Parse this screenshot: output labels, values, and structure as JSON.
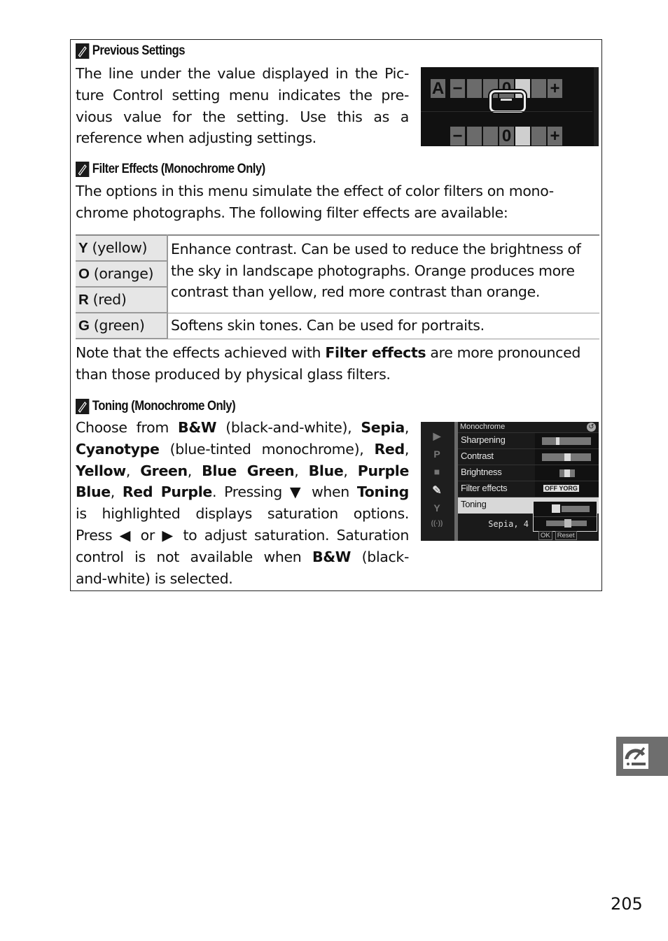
{
  "sections": {
    "previous_settings": {
      "heading": "Previous Settings",
      "lines": [
        "The line under the value displayed in the Pic-",
        "ture Control setting menu indicates the pre-",
        "vious value for the setting. Use this as a",
        "reference when adjusting settings."
      ],
      "screen": {
        "row1": [
          "A",
          "−",
          "",
          "",
          "0",
          "",
          "",
          "+"
        ],
        "row2": [
          "−",
          "",
          "",
          "0",
          "",
          "",
          "+"
        ]
      }
    },
    "filter_effects": {
      "heading": "Filter Effects (Monochrome Only)",
      "lines": [
        "The options in this menu simulate the effect of color filters on mono-",
        "chrome photographs. The following filter effects are available:"
      ],
      "table": [
        {
          "key": "Y",
          "name": "(yellow)"
        },
        {
          "key": "O",
          "name": "(orange)"
        },
        {
          "key": "R",
          "name": "(red)"
        },
        {
          "key": "G",
          "name": "(green)"
        }
      ],
      "desc_yor": [
        "Enhance contrast. Can be used to reduce the brightness of",
        "the sky in landscape photographs. Orange produces more",
        "contrast than yellow, red more contrast than orange."
      ],
      "desc_g": "Softens skin tones. Can be used for portraits.",
      "note_pre": "Note that the effects achieved with ",
      "note_bold": "Filter effects",
      "note_post": " are more pronounced",
      "note_line2": "than those produced by physical glass filters."
    },
    "toning": {
      "heading": "Toning (Monochrome Only)",
      "t": {
        "choose": "Choose from ",
        "bw": "B&W",
        "bw_desc": " (black-and-white), ",
        "sepia": "Sepia",
        "comma": ",",
        "cyan": "Cyanotype",
        "cyan_desc": " (blue-tinted monochrome), ",
        "red": "Red",
        "yellow": "Yellow",
        "green": "Green",
        "bluegreen": "Blue Green",
        "blue": "Blue",
        "purple": "Purple",
        "purpleblue2": "Blue",
        "redpurple": "Red Purple",
        "pressing": ". Pressing ▼ when ",
        "toning": "Toning",
        "l6": "is highlighted displays saturation options.",
        "l7": "Press ◀ or ▶ to adjust saturation. Saturation",
        "l8a": "control is not available when ",
        "l8b": " (black-",
        "l9": "and-white) is selected."
      },
      "screen": {
        "title": "Monochrome",
        "rows": [
          "Sharpening",
          "Contrast",
          "Brightness",
          "Filter effects",
          "Toning"
        ],
        "toning_value": "Sepia, 4",
        "filter_opts": "OFF YORG",
        "footer_ok": "OK",
        "footer_reset": "Reset",
        "side_icons": [
          "playback-icon",
          "P",
          "movie-icon",
          "picture-control-icon",
          "setup-icon",
          "wireless-icon"
        ]
      }
    }
  },
  "page_number": "205"
}
